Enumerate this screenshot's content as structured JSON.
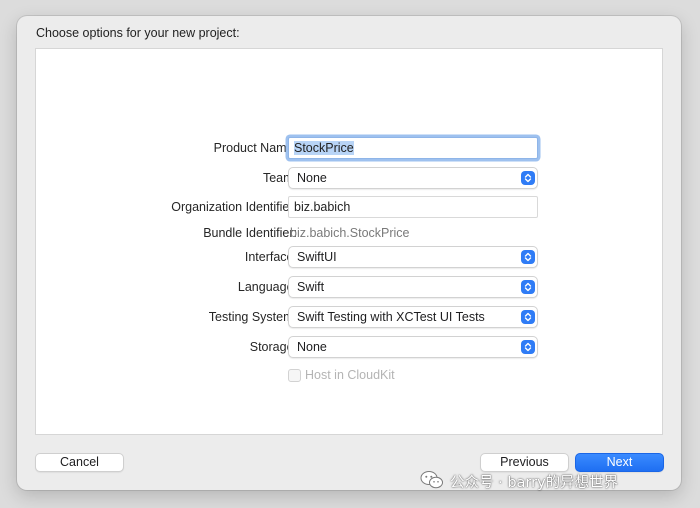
{
  "dialog": {
    "title": "Choose options for your new project:"
  },
  "form": {
    "product_name": {
      "label": "Product Name:",
      "value": "StockPrice"
    },
    "team": {
      "label": "Team:",
      "value": "None"
    },
    "organization_identifier": {
      "label": "Organization Identifier:",
      "value": "biz.babich"
    },
    "bundle_identifier": {
      "label": "Bundle Identifier:",
      "value": "biz.babich.StockPrice"
    },
    "interface": {
      "label": "Interface:",
      "value": "SwiftUI"
    },
    "language": {
      "label": "Language:",
      "value": "Swift"
    },
    "testing_system": {
      "label": "Testing System:",
      "value": "Swift Testing with XCTest UI Tests"
    },
    "storage": {
      "label": "Storage:",
      "value": "None"
    },
    "host_in_cloudkit": {
      "label": "Host in CloudKit",
      "checked": false,
      "enabled": false
    }
  },
  "buttons": {
    "cancel": "Cancel",
    "previous": "Previous",
    "next": "Next"
  },
  "watermark": {
    "text": "公众号 · barry的异想世界"
  },
  "colors": {
    "accent": "#2f7cf6",
    "focus_ring": "#9ec1ef"
  }
}
